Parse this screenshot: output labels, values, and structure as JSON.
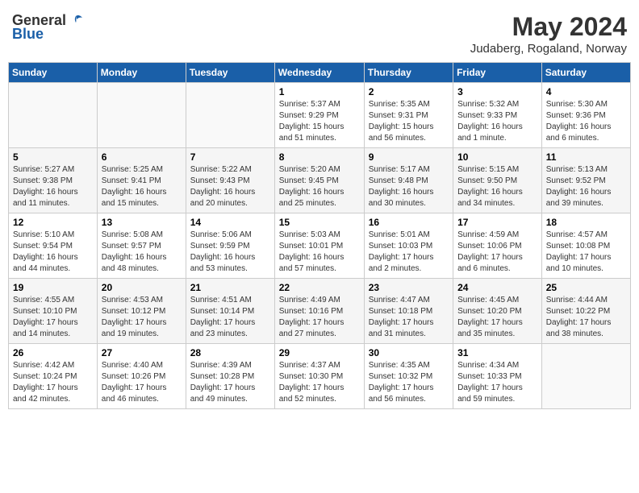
{
  "header": {
    "logo_general": "General",
    "logo_blue": "Blue",
    "month": "May 2024",
    "location": "Judaberg, Rogaland, Norway"
  },
  "days_of_week": [
    "Sunday",
    "Monday",
    "Tuesday",
    "Wednesday",
    "Thursday",
    "Friday",
    "Saturday"
  ],
  "weeks": [
    [
      {
        "day": "",
        "info": ""
      },
      {
        "day": "",
        "info": ""
      },
      {
        "day": "",
        "info": ""
      },
      {
        "day": "1",
        "info": "Sunrise: 5:37 AM\nSunset: 9:29 PM\nDaylight: 15 hours\nand 51 minutes."
      },
      {
        "day": "2",
        "info": "Sunrise: 5:35 AM\nSunset: 9:31 PM\nDaylight: 15 hours\nand 56 minutes."
      },
      {
        "day": "3",
        "info": "Sunrise: 5:32 AM\nSunset: 9:33 PM\nDaylight: 16 hours\nand 1 minute."
      },
      {
        "day": "4",
        "info": "Sunrise: 5:30 AM\nSunset: 9:36 PM\nDaylight: 16 hours\nand 6 minutes."
      }
    ],
    [
      {
        "day": "5",
        "info": "Sunrise: 5:27 AM\nSunset: 9:38 PM\nDaylight: 16 hours\nand 11 minutes."
      },
      {
        "day": "6",
        "info": "Sunrise: 5:25 AM\nSunset: 9:41 PM\nDaylight: 16 hours\nand 15 minutes."
      },
      {
        "day": "7",
        "info": "Sunrise: 5:22 AM\nSunset: 9:43 PM\nDaylight: 16 hours\nand 20 minutes."
      },
      {
        "day": "8",
        "info": "Sunrise: 5:20 AM\nSunset: 9:45 PM\nDaylight: 16 hours\nand 25 minutes."
      },
      {
        "day": "9",
        "info": "Sunrise: 5:17 AM\nSunset: 9:48 PM\nDaylight: 16 hours\nand 30 minutes."
      },
      {
        "day": "10",
        "info": "Sunrise: 5:15 AM\nSunset: 9:50 PM\nDaylight: 16 hours\nand 34 minutes."
      },
      {
        "day": "11",
        "info": "Sunrise: 5:13 AM\nSunset: 9:52 PM\nDaylight: 16 hours\nand 39 minutes."
      }
    ],
    [
      {
        "day": "12",
        "info": "Sunrise: 5:10 AM\nSunset: 9:54 PM\nDaylight: 16 hours\nand 44 minutes."
      },
      {
        "day": "13",
        "info": "Sunrise: 5:08 AM\nSunset: 9:57 PM\nDaylight: 16 hours\nand 48 minutes."
      },
      {
        "day": "14",
        "info": "Sunrise: 5:06 AM\nSunset: 9:59 PM\nDaylight: 16 hours\nand 53 minutes."
      },
      {
        "day": "15",
        "info": "Sunrise: 5:03 AM\nSunset: 10:01 PM\nDaylight: 16 hours\nand 57 minutes."
      },
      {
        "day": "16",
        "info": "Sunrise: 5:01 AM\nSunset: 10:03 PM\nDaylight: 17 hours\nand 2 minutes."
      },
      {
        "day": "17",
        "info": "Sunrise: 4:59 AM\nSunset: 10:06 PM\nDaylight: 17 hours\nand 6 minutes."
      },
      {
        "day": "18",
        "info": "Sunrise: 4:57 AM\nSunset: 10:08 PM\nDaylight: 17 hours\nand 10 minutes."
      }
    ],
    [
      {
        "day": "19",
        "info": "Sunrise: 4:55 AM\nSunset: 10:10 PM\nDaylight: 17 hours\nand 14 minutes."
      },
      {
        "day": "20",
        "info": "Sunrise: 4:53 AM\nSunset: 10:12 PM\nDaylight: 17 hours\nand 19 minutes."
      },
      {
        "day": "21",
        "info": "Sunrise: 4:51 AM\nSunset: 10:14 PM\nDaylight: 17 hours\nand 23 minutes."
      },
      {
        "day": "22",
        "info": "Sunrise: 4:49 AM\nSunset: 10:16 PM\nDaylight: 17 hours\nand 27 minutes."
      },
      {
        "day": "23",
        "info": "Sunrise: 4:47 AM\nSunset: 10:18 PM\nDaylight: 17 hours\nand 31 minutes."
      },
      {
        "day": "24",
        "info": "Sunrise: 4:45 AM\nSunset: 10:20 PM\nDaylight: 17 hours\nand 35 minutes."
      },
      {
        "day": "25",
        "info": "Sunrise: 4:44 AM\nSunset: 10:22 PM\nDaylight: 17 hours\nand 38 minutes."
      }
    ],
    [
      {
        "day": "26",
        "info": "Sunrise: 4:42 AM\nSunset: 10:24 PM\nDaylight: 17 hours\nand 42 minutes."
      },
      {
        "day": "27",
        "info": "Sunrise: 4:40 AM\nSunset: 10:26 PM\nDaylight: 17 hours\nand 46 minutes."
      },
      {
        "day": "28",
        "info": "Sunrise: 4:39 AM\nSunset: 10:28 PM\nDaylight: 17 hours\nand 49 minutes."
      },
      {
        "day": "29",
        "info": "Sunrise: 4:37 AM\nSunset: 10:30 PM\nDaylight: 17 hours\nand 52 minutes."
      },
      {
        "day": "30",
        "info": "Sunrise: 4:35 AM\nSunset: 10:32 PM\nDaylight: 17 hours\nand 56 minutes."
      },
      {
        "day": "31",
        "info": "Sunrise: 4:34 AM\nSunset: 10:33 PM\nDaylight: 17 hours\nand 59 minutes."
      },
      {
        "day": "",
        "info": ""
      }
    ]
  ]
}
